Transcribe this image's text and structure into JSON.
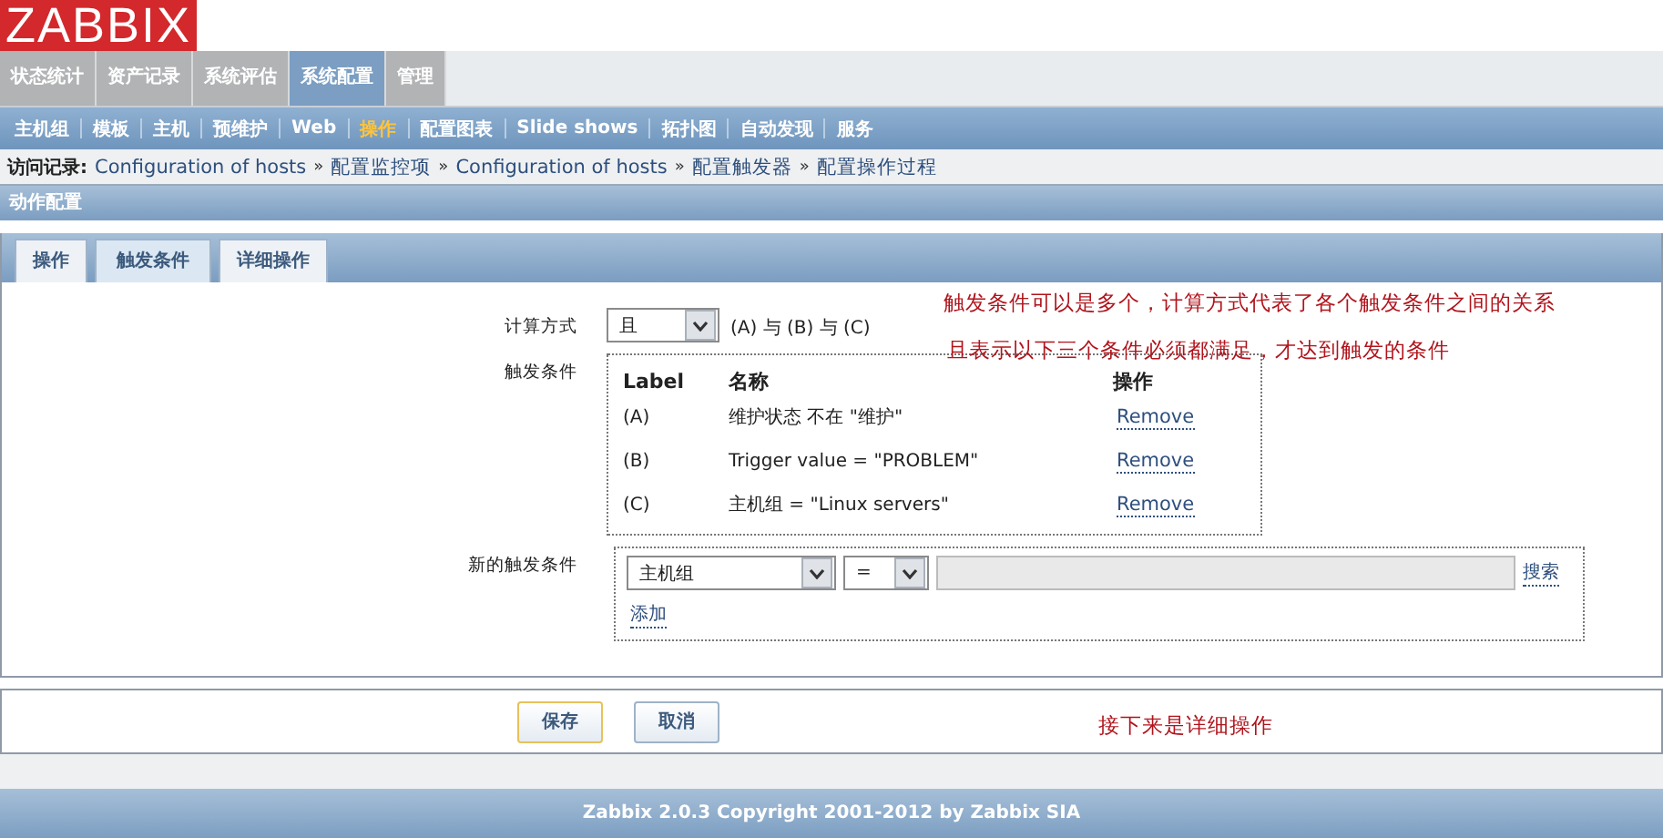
{
  "logo": "ZABBIX",
  "main_menu": [
    {
      "label": "状态统计",
      "selected": false
    },
    {
      "label": "资产记录",
      "selected": false
    },
    {
      "label": "系统评估",
      "selected": false
    },
    {
      "label": "系统配置",
      "selected": true
    },
    {
      "label": "管理",
      "selected": false
    }
  ],
  "sub_menu": [
    {
      "label": "主机组",
      "selected": false
    },
    {
      "label": "模板",
      "selected": false
    },
    {
      "label": "主机",
      "selected": false
    },
    {
      "label": "预维护",
      "selected": false
    },
    {
      "label": "Web",
      "selected": false
    },
    {
      "label": "操作",
      "selected": true
    },
    {
      "label": "配置图表",
      "selected": false
    },
    {
      "label": "Slide shows",
      "selected": false
    },
    {
      "label": "拓扑图",
      "selected": false
    },
    {
      "label": "自动发现",
      "selected": false
    },
    {
      "label": "服务",
      "selected": false
    }
  ],
  "breadcrumb": {
    "label": "访问记录:",
    "items": [
      "Configuration of hosts",
      "配置监控项",
      "Configuration of hosts",
      "配置触发器",
      "配置操作过程"
    ],
    "separator": "»"
  },
  "section_title": "动作配置",
  "tabs": [
    {
      "label": "操作",
      "selected": false
    },
    {
      "label": "触发条件",
      "selected": true
    },
    {
      "label": "详细操作",
      "selected": false
    }
  ],
  "form": {
    "calc_label": "计算方式",
    "calc_value": "且",
    "calc_expression": "(A) 与 (B) 与 (C)",
    "conditions_label": "触发条件",
    "conditions_columns": [
      "Label",
      "名称",
      "操作"
    ],
    "conditions": [
      {
        "label": "(A)",
        "name": "维护状态 不在 \"维护\"",
        "action": "Remove"
      },
      {
        "label": "(B)",
        "name": "Trigger value = \"PROBLEM\"",
        "action": "Remove"
      },
      {
        "label": "(C)",
        "name": "主机组 = \"Linux servers\"",
        "action": "Remove"
      }
    ],
    "new_label": "新的触发条件",
    "new_type": "主机组",
    "new_operator": "=",
    "search_link": "搜索",
    "add_link": "添加"
  },
  "buttons": [
    "保存",
    "取消"
  ],
  "annotations": [
    "触发条件可以是多个，计算方式代表了各个触发条件之间的关系",
    "且表示以下三个条件必须都满足，才达到触发的条件",
    "接下来是详细操作"
  ],
  "footer": "Zabbix 2.0.3 Copyright 2001-2012 by Zabbix SIA"
}
